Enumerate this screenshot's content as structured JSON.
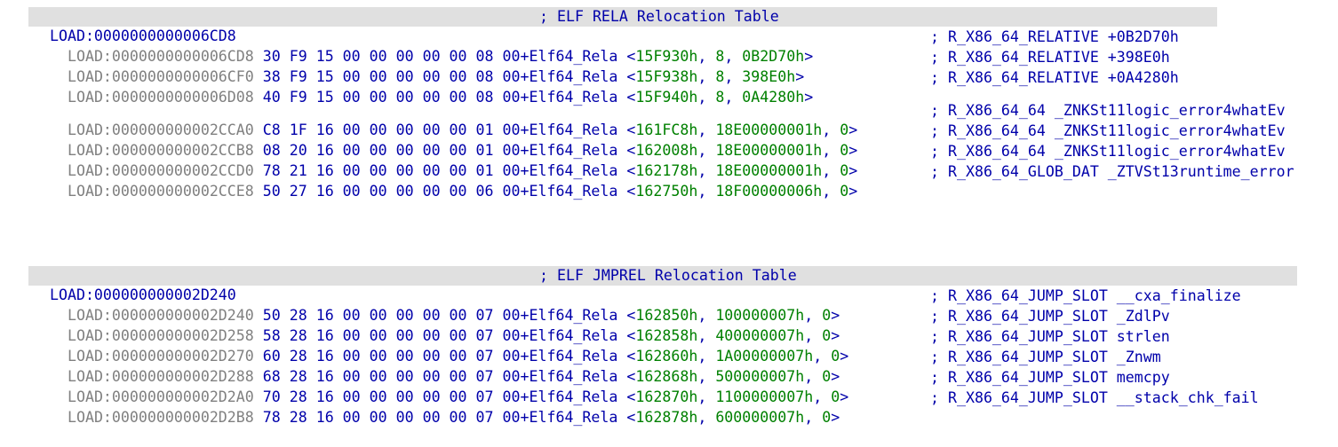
{
  "sections": [
    {
      "header": {
        "address": "LOAD:0000000000006CD8",
        "comment": "; ELF RELA Relocation Table"
      },
      "rows": [
        {
          "address": "LOAD:0000000000006CD8",
          "bytes": "30 F9 15 00 00 00 00 00 08 00+",
          "directive": "Elf64_Rela",
          "args": [
            "15F930h",
            "8",
            "0B2D70h"
          ],
          "comment": "; R_X86_64_RELATIVE +0B2D70h"
        },
        {
          "address": "LOAD:0000000000006CF0",
          "bytes": "38 F9 15 00 00 00 00 00 08 00+",
          "directive": "Elf64_Rela",
          "args": [
            "15F938h",
            "8",
            "398E0h"
          ],
          "comment": "; R_X86_64_RELATIVE +398E0h"
        },
        {
          "address": "LOAD:0000000000006D08",
          "bytes": "40 F9 15 00 00 00 00 00 08 00+",
          "directive": "Elf64_Rela",
          "args": [
            "15F940h",
            "8",
            "0A4280h"
          ],
          "comment": "; R_X86_64_RELATIVE +0A4280h"
        }
      ]
    },
    {
      "rows": [
        {
          "address": "LOAD:000000000002CCA0",
          "bytes": "C8 1F 16 00 00 00 00 00 01 00+",
          "directive": "Elf64_Rela",
          "args": [
            "161FC8h",
            "18E00000001h",
            "0"
          ],
          "comment": "; R_X86_64_64 _ZNKSt11logic_error4whatEv"
        },
        {
          "address": "LOAD:000000000002CCB8",
          "bytes": "08 20 16 00 00 00 00 00 01 00+",
          "directive": "Elf64_Rela",
          "args": [
            "162008h",
            "18E00000001h",
            "0"
          ],
          "comment": "; R_X86_64_64 _ZNKSt11logic_error4whatEv"
        },
        {
          "address": "LOAD:000000000002CCD0",
          "bytes": "78 21 16 00 00 00 00 00 01 00+",
          "directive": "Elf64_Rela",
          "args": [
            "162178h",
            "18E00000001h",
            "0"
          ],
          "comment": "; R_X86_64_64 _ZNKSt11logic_error4whatEv"
        },
        {
          "address": "LOAD:000000000002CCE8",
          "bytes": "50 27 16 00 00 00 00 00 06 00+",
          "directive": "Elf64_Rela",
          "args": [
            "162750h",
            "18F00000006h",
            "0"
          ],
          "comment": "; R_X86_64_GLOB_DAT _ZTVSt13runtime_error"
        }
      ]
    },
    {
      "header": {
        "address": "LOAD:000000000002D240",
        "comment": "; ELF JMPREL Relocation Table"
      },
      "rows": [
        {
          "address": "LOAD:000000000002D240",
          "bytes": "50 28 16 00 00 00 00 00 07 00+",
          "directive": "Elf64_Rela",
          "args": [
            "162850h",
            "100000007h",
            "0"
          ],
          "comment": "; R_X86_64_JUMP_SLOT __cxa_finalize"
        },
        {
          "address": "LOAD:000000000002D258",
          "bytes": "58 28 16 00 00 00 00 00 07 00+",
          "directive": "Elf64_Rela",
          "args": [
            "162858h",
            "400000007h",
            "0"
          ],
          "comment": "; R_X86_64_JUMP_SLOT _ZdlPv"
        },
        {
          "address": "LOAD:000000000002D270",
          "bytes": "60 28 16 00 00 00 00 00 07 00+",
          "directive": "Elf64_Rela",
          "args": [
            "162860h",
            "1A00000007h",
            "0"
          ],
          "comment": "; R_X86_64_JUMP_SLOT strlen"
        },
        {
          "address": "LOAD:000000000002D288",
          "bytes": "68 28 16 00 00 00 00 00 07 00+",
          "directive": "Elf64_Rela",
          "args": [
            "162868h",
            "500000007h",
            "0"
          ],
          "comment": "; R_X86_64_JUMP_SLOT _Znwm"
        },
        {
          "address": "LOAD:000000000002D2A0",
          "bytes": "70 28 16 00 00 00 00 00 07 00+",
          "directive": "Elf64_Rela",
          "args": [
            "162870h",
            "1100000007h",
            "0"
          ],
          "comment": "; R_X86_64_JUMP_SLOT memcpy"
        },
        {
          "address": "LOAD:000000000002D2B8",
          "bytes": "78 28 16 00 00 00 00 00 07 00+",
          "directive": "Elf64_Rela",
          "args": [
            "162878h",
            "600000007h",
            "0"
          ],
          "comment": "; R_X86_64_JUMP_SLOT __stack_chk_fail"
        }
      ]
    }
  ]
}
